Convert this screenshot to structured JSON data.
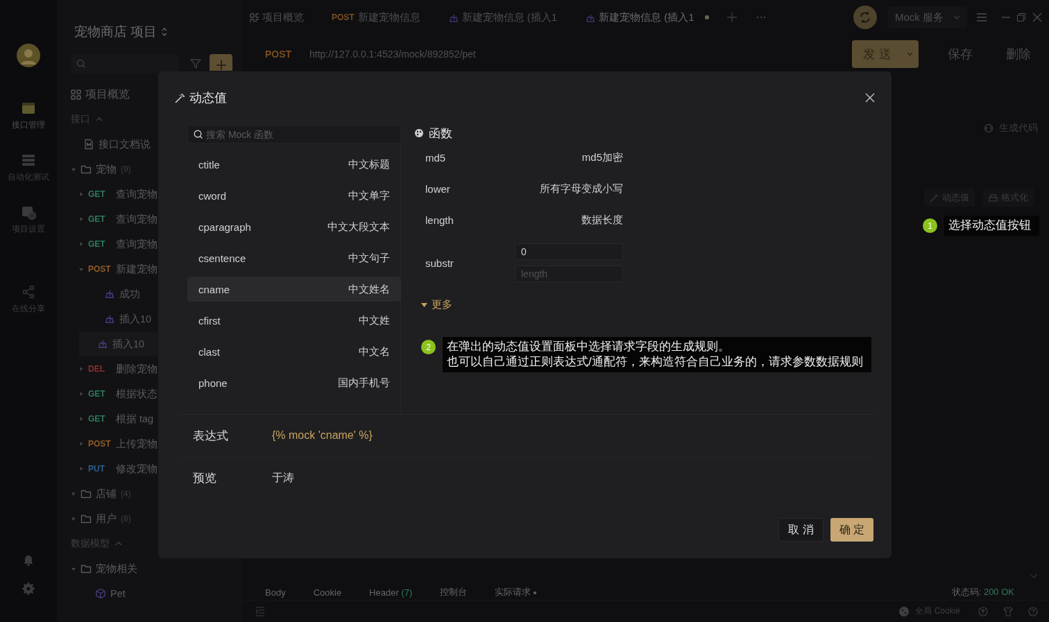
{
  "rail": {
    "items": [
      {
        "kind": "api",
        "label": "接口管理",
        "selected": true
      },
      {
        "kind": "test",
        "label": "自动化测试",
        "selected": false
      },
      {
        "kind": "settings",
        "label": "项目设置",
        "selected": false
      },
      {
        "kind": "share",
        "label": "在线分享",
        "selected": false
      }
    ]
  },
  "sidebar": {
    "project_title": "宠物商店 项目",
    "overview": "项目概览",
    "api_section": "接口",
    "tree": [
      {
        "kind": "doc",
        "name": "接口文档说",
        "selected": false
      },
      {
        "kind": "folder",
        "name": "宠物",
        "count": "(9)",
        "expanded": true,
        "selected": false,
        "children": [
          {
            "kind": "endpoint",
            "method": "GET",
            "color": "#2f7a5c",
            "name": "查询宠物",
            "expanded": false,
            "selected": false
          },
          {
            "kind": "endpoint",
            "method": "GET",
            "color": "#2f7a5c",
            "name": "查询宠物",
            "expanded": false,
            "selected": false
          },
          {
            "kind": "endpoint",
            "method": "GET",
            "color": "#2f7a5c",
            "name": "查询宠物",
            "expanded": false,
            "selected": false
          },
          {
            "kind": "endpoint",
            "method": "POST",
            "color": "#8e5a26",
            "name": "新建宠物",
            "expanded": true,
            "selected": false,
            "children": [
              {
                "kind": "case",
                "name": "成功",
                "selected": false
              },
              {
                "kind": "case",
                "name": "插入10",
                "selected": false
              },
              {
                "kind": "case",
                "name": "插入10",
                "selected": true
              }
            ]
          },
          {
            "kind": "endpoint",
            "method": "DEL",
            "color": "#8a3030",
            "name": "删除宠物",
            "expanded": false,
            "selected": false
          },
          {
            "kind": "endpoint",
            "method": "GET",
            "color": "#2f7a5c",
            "name": "根据状态",
            "expanded": false,
            "selected": false
          },
          {
            "kind": "endpoint",
            "method": "GET",
            "color": "#2f7a5c",
            "name": "根据 tag",
            "expanded": false,
            "selected": false
          },
          {
            "kind": "endpoint",
            "method": "POST",
            "color": "#8e5a26",
            "name": "上传宠物",
            "expanded": false,
            "selected": false
          },
          {
            "kind": "endpoint",
            "method": "PUT",
            "color": "#2d5c8e",
            "name": "修改宠物",
            "expanded": false,
            "selected": false
          }
        ]
      },
      {
        "kind": "folder",
        "name": "店铺",
        "count": "(4)",
        "expanded": false,
        "selected": false
      },
      {
        "kind": "folder",
        "name": "用户",
        "count": "(8)",
        "expanded": false,
        "selected": false
      }
    ],
    "model_section": "数据模型",
    "models": [
      {
        "kind": "folder",
        "name": "宠物相关",
        "expanded": true,
        "selected": false,
        "children": [
          {
            "kind": "model",
            "name": "Pet",
            "selected": false
          }
        ]
      }
    ]
  },
  "tabs": [
    {
      "kind": "overview",
      "label": "项目概览",
      "selected": false
    },
    {
      "kind": "endpoint",
      "method": "POST",
      "label": "新建宠物信息",
      "selected": false
    },
    {
      "kind": "case",
      "label": "新建宠物信息 (插入1",
      "selected": false,
      "unsaved": false
    },
    {
      "kind": "case",
      "label": "新建宠物信息 (插入1",
      "selected": true,
      "unsaved": true
    }
  ],
  "environment": "Mock 服务",
  "request": {
    "method": "POST",
    "url": "http://127.0.0.1:4523/mock/892852/pet",
    "send": "发 送",
    "save": "保存",
    "delete": "删除"
  },
  "generate_code": "生成代码",
  "body_tools": [
    {
      "kind": "dynamic",
      "label": "动态值"
    },
    {
      "kind": "format",
      "label": "格式化"
    }
  ],
  "response_tabs": [
    {
      "label": "Body"
    },
    {
      "label": "Cookie"
    },
    {
      "label": "Header",
      "count": "(7)"
    },
    {
      "label": "控制台"
    },
    {
      "label": "实际请求",
      "dot": true
    }
  ],
  "status": {
    "label": "状态码:",
    "value": "200 OK"
  },
  "status_bar": {
    "cookie": "全局 Cookie"
  },
  "dialog": {
    "title": "动态值",
    "search": {
      "placeholder": "搜索 Mock 函数"
    },
    "functions": [
      {
        "name": "ctitle",
        "desc": "中文标题",
        "selected": false
      },
      {
        "name": "cword",
        "desc": "中文单字",
        "selected": false
      },
      {
        "name": "cparagraph",
        "desc": "中文大段文本",
        "selected": false
      },
      {
        "name": "csentence",
        "desc": "中文句子",
        "selected": false
      },
      {
        "name": "cname",
        "desc": "中文姓名",
        "selected": true
      },
      {
        "name": "cfirst",
        "desc": "中文姓",
        "selected": false
      },
      {
        "name": "clast",
        "desc": "中文名",
        "selected": false
      },
      {
        "name": "phone",
        "desc": "国内手机号",
        "selected": false
      }
    ],
    "section": "函数",
    "params": [
      {
        "kind": "plain",
        "name": "md5",
        "desc": "md5加密"
      },
      {
        "kind": "plain",
        "name": "lower",
        "desc": "所有字母变成小写"
      },
      {
        "kind": "plain",
        "name": "length",
        "desc": "数据长度"
      },
      {
        "kind": "inputs",
        "name": "substr",
        "inputs": [
          {
            "value": "0"
          },
          {
            "placeholder": "length"
          }
        ]
      }
    ],
    "more": {
      "label": "更多",
      "expanded": true
    },
    "expression": {
      "label": "表达式",
      "value": "{% mock 'cname' %}"
    },
    "preview": {
      "label": "预览",
      "value": "于涛"
    },
    "cancel": "取 消",
    "confirm": "确 定"
  },
  "hints": [
    {
      "number": "1",
      "lines": [
        "选择动态值按钮"
      ]
    },
    {
      "number": "2",
      "lines": [
        "在弹出的动态值设置面板中选择请求字段的生成规则。",
        "也可以自己通过正则表达式/通配符，来构造符合自己业务的，请求参数数据规则"
      ]
    }
  ]
}
